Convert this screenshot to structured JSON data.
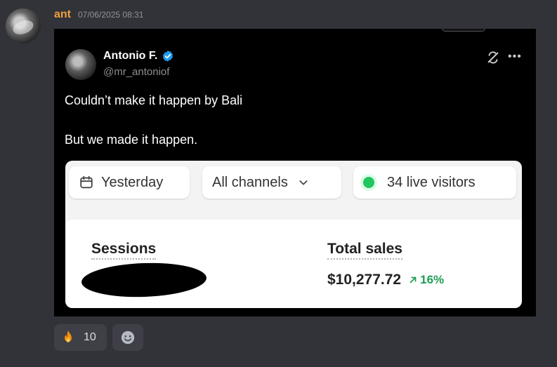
{
  "message": {
    "username": "ant",
    "timestamp": "07/06/2025 08:31",
    "username_color": "#f2a03d"
  },
  "tweet": {
    "author_name": "Antonio F.",
    "author_handle": "@mr_antoniof",
    "verified_color": "#1d9bf0",
    "text_line1": "Couldn’t make it happen by Bali",
    "text_line2": "But we made it happen.",
    "screenshot": {
      "filter_date": "Yesterday",
      "filter_channel": "All channels",
      "live_visitors": "34 live visitors",
      "sessions_label": "Sessions",
      "total_sales_label": "Total sales",
      "total_sales_value": "$10,277.72",
      "total_sales_change": "16%",
      "live_dot_color": "#22c55e",
      "change_color": "#1f9d55"
    }
  },
  "reactions": [
    {
      "icon": "fire-icon",
      "count": "10"
    },
    {
      "icon": "add-reaction-icon"
    }
  ]
}
